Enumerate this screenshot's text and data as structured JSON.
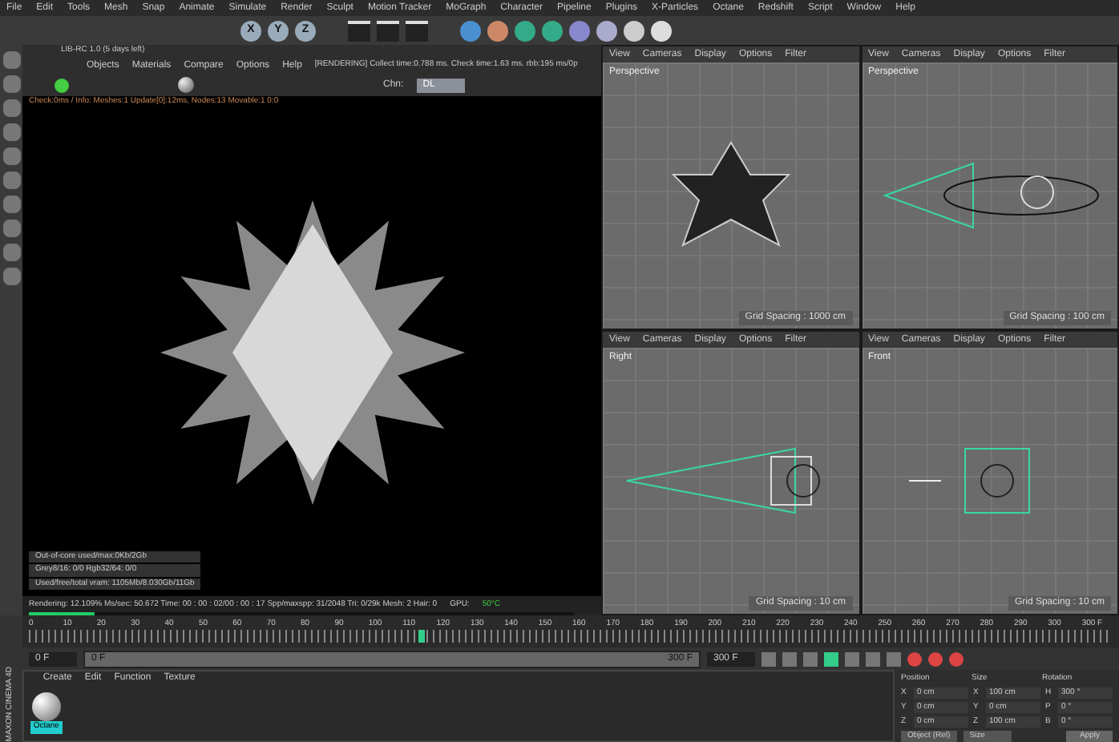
{
  "menu": [
    "File",
    "Edit",
    "Tools",
    "Mesh",
    "Snap",
    "Animate",
    "Simulate",
    "Render",
    "Sculpt",
    "Motion Tracker",
    "MoGraph",
    "Character",
    "Pipeline",
    "Plugins",
    "X-Particles",
    "Octane",
    "Redshift",
    "Script",
    "Window",
    "Help"
  ],
  "toolbar_axes": [
    "X",
    "Y",
    "Z"
  ],
  "render_view": {
    "title": "LIB-RC 1.0 (5 days left)",
    "menu": [
      "Objects",
      "Materials",
      "Compare",
      "Options",
      "Help"
    ],
    "message": "[RENDERING] Collect time:0.788 ms.  Check time:1.63 ms.  rbb:195 ms/0p",
    "channel_label": "Chn:",
    "channel_value": "DL",
    "info_line": "Check:0ms / Info: Meshes:1 Update[0]:12ms, Nodes:13 Movable:1 0:0",
    "stats": [
      "Out-of-core used/max:0Kb/2Gb",
      "Grey8/16: 0/0     Rgb32/64: 0/0",
      "Used/free/total vram: 1105Mb/8.030Gb/11Gb"
    ],
    "status": "Rendering: 12.109%  Ms/sec: 50.672   Time: 00 : 00 : 02/00 : 00 : 17   Spp/maxspp: 31/2048   Tri: 0/29k   Mesh: 2   Hair: 0",
    "gpu_label": "GPU:",
    "gpu_value": "50°C",
    "progress": {
      "level": 0.12
    }
  },
  "viewports": [
    {
      "menu": [
        "View",
        "Cameras",
        "Display",
        "Options",
        "Filter"
      ],
      "label": "Perspective",
      "grid": "Grid Spacing : 1000 cm",
      "kind": "perspective_object"
    },
    {
      "menu": [
        "View",
        "Cameras",
        "Display",
        "Options",
        "Filter"
      ],
      "label": "Perspective",
      "grid": "Grid Spacing : 100 cm",
      "kind": "perspective_camera"
    },
    {
      "menu": [
        "View",
        "Cameras",
        "Display",
        "Options",
        "Filter"
      ],
      "label": "Right",
      "grid": "Grid Spacing : 10 cm",
      "kind": "side"
    },
    {
      "menu": [
        "View",
        "Cameras",
        "Display",
        "Options",
        "Filter"
      ],
      "label": "Front",
      "grid": "Grid Spacing : 10 cm",
      "kind": "front"
    }
  ],
  "timeline": {
    "ticks": [
      "0",
      "10",
      "20",
      "30",
      "40",
      "50",
      "60",
      "70",
      "80",
      "90",
      "100",
      "110",
      "120",
      "130",
      "140",
      "150",
      "160",
      "170",
      "180",
      "190",
      "200",
      "210",
      "220",
      "230",
      "240",
      "250",
      "260",
      "270",
      "280",
      "290",
      "300"
    ],
    "playhead": {
      "level": 0.36
    },
    "end_label": "300 F"
  },
  "transport": {
    "range": {
      "level": 1
    },
    "start_field": "0 F",
    "slider_start": "0 F",
    "slider_end": "300 F",
    "end_field": "300 F"
  },
  "materials": {
    "menu": [
      "Create",
      "Edit",
      "Function",
      "Texture"
    ],
    "items": [
      {
        "name": "Octane",
        "selected": true
      }
    ]
  },
  "coordinates": {
    "headers": [
      "Position",
      "Size",
      "Rotation"
    ],
    "rows": [
      [
        "X",
        "0 cm",
        "X",
        "100 cm",
        "H",
        "300 °"
      ],
      [
        "Y",
        "0 cm",
        "Y",
        "0 cm",
        "P",
        "0 °"
      ],
      [
        "Z",
        "0 cm",
        "Z",
        "100 cm",
        "B",
        "0 °"
      ]
    ],
    "mode": "Object (Rel)",
    "size_mode": "Size",
    "apply": "Apply"
  },
  "brand": "MAXON CINEMA 4D"
}
